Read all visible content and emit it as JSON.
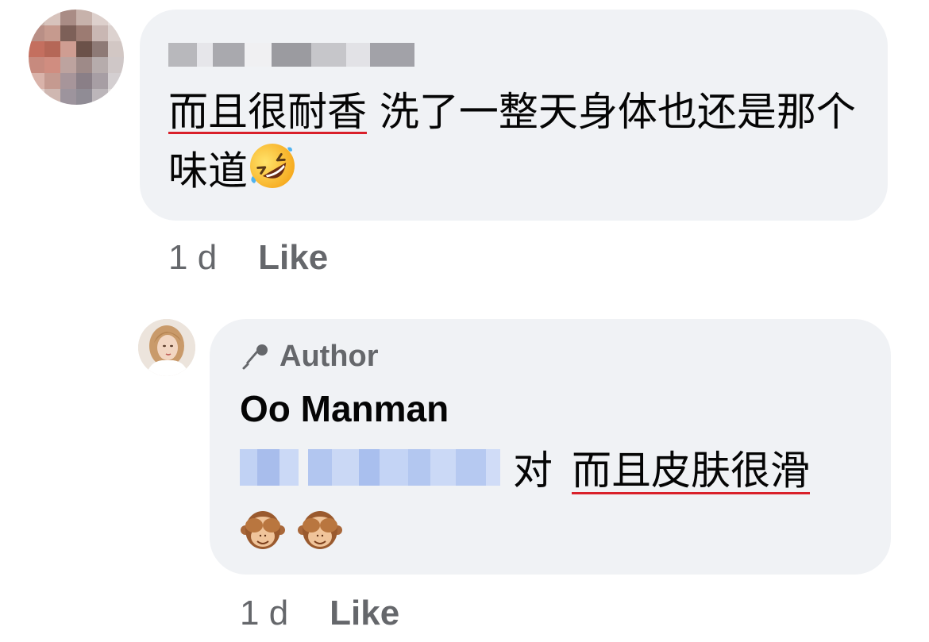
{
  "comment": {
    "text_underlined": "而且很耐香",
    "text_rest": " 洗了一整天身体也还是那个味道",
    "emoji": "rolling-on-floor-laughing",
    "time": "1 d",
    "like_label": "Like"
  },
  "reply": {
    "author_badge": "Author",
    "author_name": "Oo Manman",
    "reply_word": "对",
    "text_underlined": "而且皮肤很滑",
    "emoji": "see-no-evil-monkey",
    "emoji_count": 2,
    "time": "1 d",
    "like_label": "Like"
  },
  "colors": {
    "bubble_bg": "#f0f2f5",
    "meta_gray": "#65676b",
    "underline_red": "#d9202a",
    "mention_blue": "#b7c9ef"
  }
}
